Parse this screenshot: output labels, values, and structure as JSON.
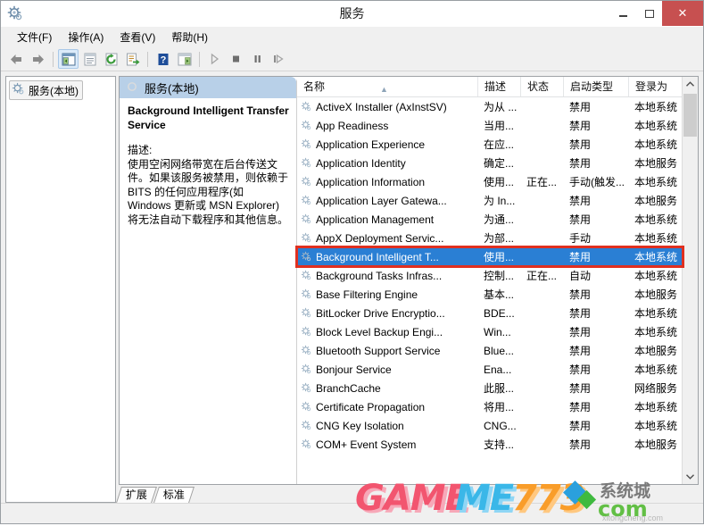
{
  "window": {
    "title": "服务",
    "icon": "services-gear-icon",
    "minimize_label": "–",
    "maximize_label": "□",
    "close_label": "✕",
    "close_color": "#c75050"
  },
  "menubar": {
    "items": [
      {
        "label": "文件(F)",
        "name": "menu-file"
      },
      {
        "label": "操作(A)",
        "name": "menu-action"
      },
      {
        "label": "查看(V)",
        "name": "menu-view"
      },
      {
        "label": "帮助(H)",
        "name": "menu-help"
      }
    ]
  },
  "toolbar": {
    "buttons": [
      {
        "name": "back-button",
        "icon": "left-arrow-icon",
        "title": "后退"
      },
      {
        "name": "forward-button",
        "icon": "right-arrow-icon",
        "title": "前进"
      },
      {
        "name": "show-hide-tree-button",
        "icon": "console-tree-icon",
        "title": "显示/隐藏控制台树"
      },
      {
        "name": "properties-button",
        "icon": "properties-icon",
        "title": "属性"
      },
      {
        "name": "refresh-button",
        "icon": "refresh-icon",
        "title": "刷新"
      },
      {
        "name": "export-list-button",
        "icon": "export-list-icon",
        "title": "导出列表"
      },
      {
        "name": "help-button",
        "icon": "help-question-icon",
        "title": "帮助"
      },
      {
        "name": "show-action-pane-button",
        "icon": "action-pane-icon",
        "title": "显示操作窗格"
      },
      {
        "name": "start-service-button",
        "icon": "play-icon",
        "title": "启动服务"
      },
      {
        "name": "stop-service-button",
        "icon": "stop-icon",
        "title": "停止服务"
      },
      {
        "name": "pause-service-button",
        "icon": "pause-icon",
        "title": "暂停服务"
      },
      {
        "name": "restart-service-button",
        "icon": "restart-icon",
        "title": "重启服务"
      }
    ]
  },
  "tree": {
    "root": {
      "label": "服务(本地)",
      "icon": "services-gear-icon"
    }
  },
  "details": {
    "header": {
      "label": "服务(本地)",
      "icon": "services-circle-icon"
    },
    "service_name": "Background Intelligent Transfer Service",
    "description_label": "描述:",
    "description": "使用空闲网络带宽在后台传送文件。如果该服务被禁用，则依赖于 BITS 的任何应用程序(如 Windows 更新或 MSN Explorer)将无法自动下载程序和其他信息。"
  },
  "list": {
    "columns": [
      {
        "label": "名称",
        "name": "column-name",
        "sorted": "asc"
      },
      {
        "label": "描述",
        "name": "column-description"
      },
      {
        "label": "状态",
        "name": "column-status"
      },
      {
        "label": "启动类型",
        "name": "column-startup-type"
      },
      {
        "label": "登录为",
        "name": "column-log-on-as"
      }
    ],
    "rows": [
      {
        "name": "ActiveX Installer (AxInstSV)",
        "desc": "为从 ...",
        "status": "",
        "startup": "禁用",
        "logon": "本地系统",
        "selected": false
      },
      {
        "name": "App Readiness",
        "desc": "当用...",
        "status": "",
        "startup": "禁用",
        "logon": "本地系统",
        "selected": false
      },
      {
        "name": "Application Experience",
        "desc": "在应...",
        "status": "",
        "startup": "禁用",
        "logon": "本地系统",
        "selected": false
      },
      {
        "name": "Application Identity",
        "desc": "确定...",
        "status": "",
        "startup": "禁用",
        "logon": "本地服务",
        "selected": false
      },
      {
        "name": "Application Information",
        "desc": "使用...",
        "status": "正在...",
        "startup": "手动(触发...",
        "logon": "本地系统",
        "selected": false
      },
      {
        "name": "Application Layer Gatewa...",
        "desc": "为 In...",
        "status": "",
        "startup": "禁用",
        "logon": "本地服务",
        "selected": false
      },
      {
        "name": "Application Management",
        "desc": "为通...",
        "status": "",
        "startup": "禁用",
        "logon": "本地系统",
        "selected": false
      },
      {
        "name": "AppX Deployment Servic...",
        "desc": "为部...",
        "status": "",
        "startup": "手动",
        "logon": "本地系统",
        "selected": false
      },
      {
        "name": "Background Intelligent T...",
        "desc": "使用...",
        "status": "",
        "startup": "禁用",
        "logon": "本地系统",
        "selected": true
      },
      {
        "name": "Background Tasks Infras...",
        "desc": "控制...",
        "status": "正在...",
        "startup": "自动",
        "logon": "本地系统",
        "selected": false
      },
      {
        "name": "Base Filtering Engine",
        "desc": "基本...",
        "status": "",
        "startup": "禁用",
        "logon": "本地服务",
        "selected": false
      },
      {
        "name": "BitLocker Drive Encryptio...",
        "desc": "BDE...",
        "status": "",
        "startup": "禁用",
        "logon": "本地系统",
        "selected": false
      },
      {
        "name": "Block Level Backup Engi...",
        "desc": "Win...",
        "status": "",
        "startup": "禁用",
        "logon": "本地系统",
        "selected": false
      },
      {
        "name": "Bluetooth Support Service",
        "desc": "Blue...",
        "status": "",
        "startup": "禁用",
        "logon": "本地服务",
        "selected": false
      },
      {
        "name": "Bonjour Service",
        "desc": "Ena...",
        "status": "",
        "startup": "禁用",
        "logon": "本地系统",
        "selected": false
      },
      {
        "name": "BranchCache",
        "desc": "此服...",
        "status": "",
        "startup": "禁用",
        "logon": "网络服务",
        "selected": false
      },
      {
        "name": "Certificate Propagation",
        "desc": "将用...",
        "status": "",
        "startup": "禁用",
        "logon": "本地系统",
        "selected": false
      },
      {
        "name": "CNG Key Isolation",
        "desc": "CNG...",
        "status": "",
        "startup": "禁用",
        "logon": "本地系统",
        "selected": false
      },
      {
        "name": "COM+ Event System",
        "desc": "支持...",
        "status": "",
        "startup": "禁用",
        "logon": "本地服务",
        "selected": false
      }
    ],
    "selection_highlight_color": "#2a7fd4",
    "annotation_box_color": "#e03020"
  },
  "tabs": [
    {
      "label": "扩展",
      "name": "tab-extended",
      "selected": false
    },
    {
      "label": "标准",
      "name": "tab-standard",
      "selected": true
    }
  ],
  "watermark": {
    "text_game": "GAME",
    "text_773": "773",
    "text_cn": "系统城",
    "text_com": "com",
    "text_url": "xitongcheng.com"
  }
}
